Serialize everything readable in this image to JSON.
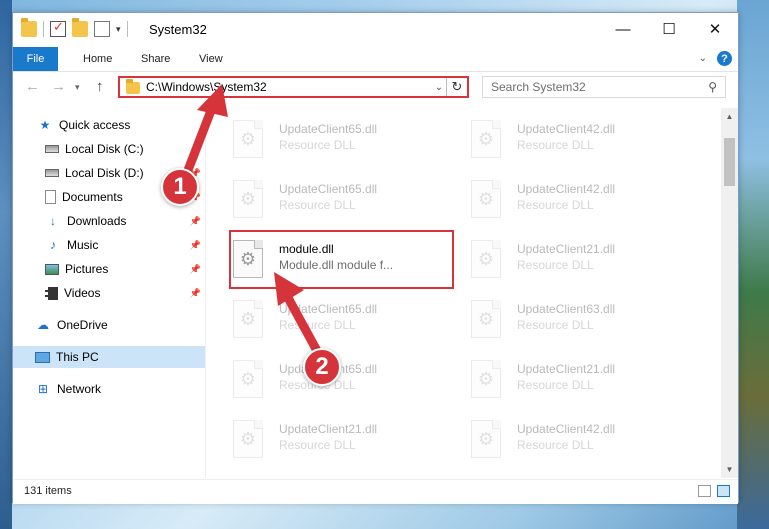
{
  "window": {
    "title": "System32",
    "controls": {
      "minimize": "—",
      "maximize": "☐",
      "close": "✕"
    }
  },
  "ribbon": {
    "tabs": [
      "File",
      "Home",
      "Share",
      "View"
    ]
  },
  "address": {
    "path": "C:\\Windows\\System32",
    "search_placeholder": "Search System32"
  },
  "sidebar": {
    "items": [
      {
        "label": "Quick access",
        "icon": "star-icon",
        "pinned": false
      },
      {
        "label": "Local Disk (C:)",
        "icon": "disk-icon",
        "pinned": false
      },
      {
        "label": "Local Disk (D:)",
        "icon": "disk-icon",
        "pinned": true
      },
      {
        "label": "Documents",
        "icon": "documents-icon",
        "pinned": true
      },
      {
        "label": "Downloads",
        "icon": "download-icon",
        "pinned": true
      },
      {
        "label": "Music",
        "icon": "music-icon",
        "pinned": true
      },
      {
        "label": "Pictures",
        "icon": "pictures-icon",
        "pinned": true
      },
      {
        "label": "Videos",
        "icon": "videos-icon",
        "pinned": true
      },
      {
        "label": "OneDrive",
        "icon": "cloud-icon",
        "pinned": false
      },
      {
        "label": "This PC",
        "icon": "computer-icon",
        "pinned": false,
        "selected": true
      },
      {
        "label": "Network",
        "icon": "network-icon",
        "pinned": false
      }
    ]
  },
  "files": [
    {
      "name": "UpdateClient65.dll",
      "desc": "Resource DLL",
      "faded": true
    },
    {
      "name": "UpdateClient42.dll",
      "desc": "Resource DLL",
      "faded": true
    },
    {
      "name": "UpdateClient65.dll",
      "desc": "Resource DLL",
      "faded": true
    },
    {
      "name": "UpdateClient42.dll",
      "desc": "Resource DLL",
      "faded": true
    },
    {
      "name": "module.dll",
      "desc": "Module.dll module f...",
      "faded": false
    },
    {
      "name": "UpdateClient21.dll",
      "desc": "Resource DLL",
      "faded": true
    },
    {
      "name": "UpdateClient65.dll",
      "desc": "Resource DLL",
      "faded": true
    },
    {
      "name": "UpdateClient63.dll",
      "desc": "Resource DLL",
      "faded": true
    },
    {
      "name": "UpdateClient65.dll",
      "desc": "Resource DLL",
      "faded": true
    },
    {
      "name": "UpdateClient21.dll",
      "desc": "Resource DLL",
      "faded": true
    },
    {
      "name": "UpdateClient21.dll",
      "desc": "Resource DLL",
      "faded": true
    },
    {
      "name": "UpdateClient42.dll",
      "desc": "Resource DLL",
      "faded": true
    }
  ],
  "status": {
    "item_count": "131 items"
  },
  "annotations": {
    "step1": "1",
    "step2": "2",
    "color": "#d6343b"
  }
}
